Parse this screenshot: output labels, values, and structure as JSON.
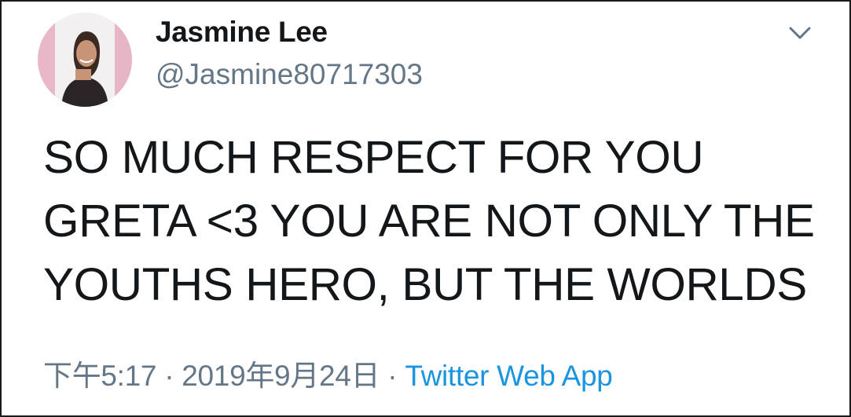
{
  "tweet": {
    "author": {
      "display_name": "Jasmine Lee",
      "handle": "@Jasmine80717303",
      "avatar_icon": "profile-photo"
    },
    "menu_icon": "chevron-down-icon",
    "text": "SO MUCH RESPECT FOR YOU\nGRETA <3 YOU ARE NOT ONLY THE\nYOUTHS HERO, BUT THE WORLDS",
    "time": "下午5:17",
    "separator": "·",
    "date": "2019年9月24日",
    "source": "Twitter Web App"
  },
  "colors": {
    "text_primary": "#14171a",
    "text_secondary": "#657786",
    "link": "#1b95e0",
    "border": "#1a1a1a"
  }
}
